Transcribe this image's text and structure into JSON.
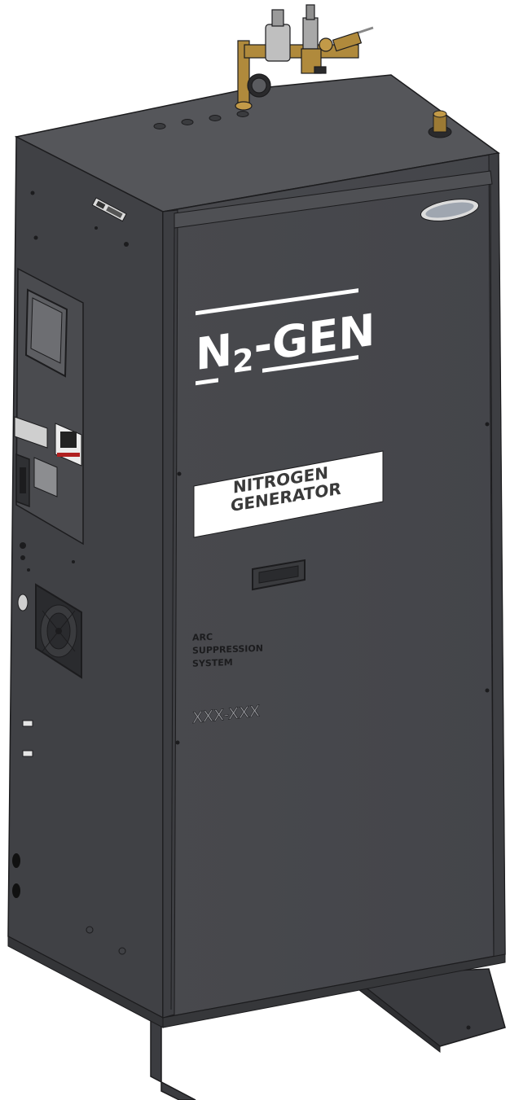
{
  "product": {
    "logo_main": "N",
    "logo_sub": "2",
    "logo_suffix": "-GEN",
    "label_line1": "NITROGEN",
    "label_line2": "GENERATOR",
    "system_line1": "ARC",
    "system_line2": "SUPPRESSION",
    "system_line3": "SYSTEM",
    "serial": "XXX-XXX"
  },
  "colors": {
    "cabinet": "#46474b",
    "cabinet_side": "#404145",
    "cabinet_top": "#55565a",
    "outline": "#1c1c1e",
    "brass": "#b08a3c",
    "label_bg": "#ffffff"
  }
}
